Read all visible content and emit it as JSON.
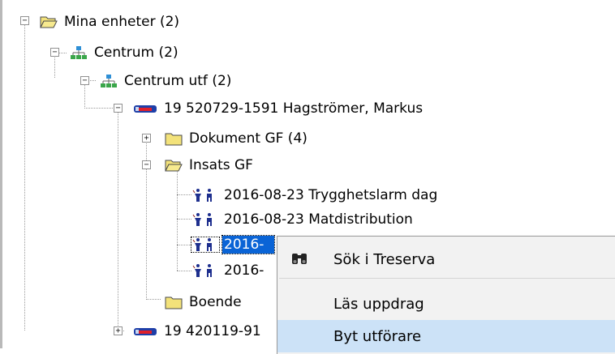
{
  "tree": {
    "top_partial": "· · · ·",
    "root": {
      "label": "Mina enheter (2)"
    },
    "centrum": {
      "label": "Centrum (2)"
    },
    "centrum_utf": {
      "label": "Centrum utf (2)"
    },
    "person1": {
      "label": "19 520729-1591 Hagströmer, Markus"
    },
    "dokument": {
      "label": "Dokument GF (4)"
    },
    "insats": {
      "label": "Insats GF"
    },
    "items": [
      {
        "label": "2016-08-23 Trygghetslarm dag"
      },
      {
        "label": "2016-08-23 Matdistribution"
      },
      {
        "label": "2016-"
      },
      {
        "label": "2016-"
      }
    ],
    "boende": {
      "label": "Boende"
    },
    "person2": {
      "label": "19 420119-91"
    }
  },
  "context_menu": {
    "search": "Sök i Treserva",
    "read": "Läs uppdrag",
    "change": "Byt utförare"
  },
  "colors": {
    "selection": "#0a64d6",
    "menu_hover": "#cce2f7",
    "folder": "#f3e27a"
  }
}
